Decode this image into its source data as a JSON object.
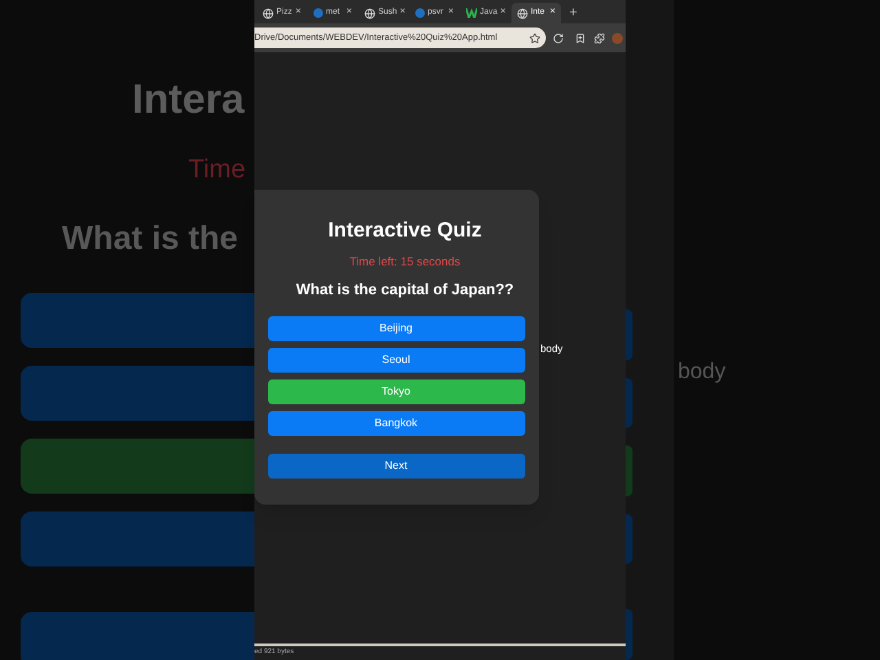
{
  "browser": {
    "tabs": [
      {
        "label": "Pizz",
        "kind": "globe",
        "selected": false
      },
      {
        "label": "met",
        "kind": "square",
        "selected": false
      },
      {
        "label": "Sush",
        "kind": "globe",
        "selected": false
      },
      {
        "label": "psvr",
        "kind": "square",
        "selected": false
      },
      {
        "label": "Java",
        "kind": "w",
        "selected": false
      },
      {
        "label": "Inte",
        "kind": "globe",
        "selected": true
      }
    ],
    "new_tab": "+",
    "close": "×",
    "address": "Drive/Documents/WEBDEV/Interactive%20Quiz%20App.html"
  },
  "quiz": {
    "title": "Interactive Quiz",
    "timer": "Time left: 15 seconds",
    "question": "What is the capital of Japan??",
    "options": [
      {
        "label": "Beijing",
        "correct": false
      },
      {
        "label": "Seoul",
        "correct": false
      },
      {
        "label": "Tokyo",
        "correct": true
      },
      {
        "label": "Bangkok",
        "correct": false
      }
    ],
    "next": "Next"
  },
  "body_label": "body",
  "status_text": "ed 921 bytes",
  "backdrop": {
    "title": "Intera",
    "timer": "Time",
    "question": "What is the",
    "body_label": "body",
    "bars": [
      {
        "correct": false
      },
      {
        "correct": false
      },
      {
        "correct": true
      },
      {
        "correct": false
      },
      {
        "correct": false
      }
    ]
  }
}
